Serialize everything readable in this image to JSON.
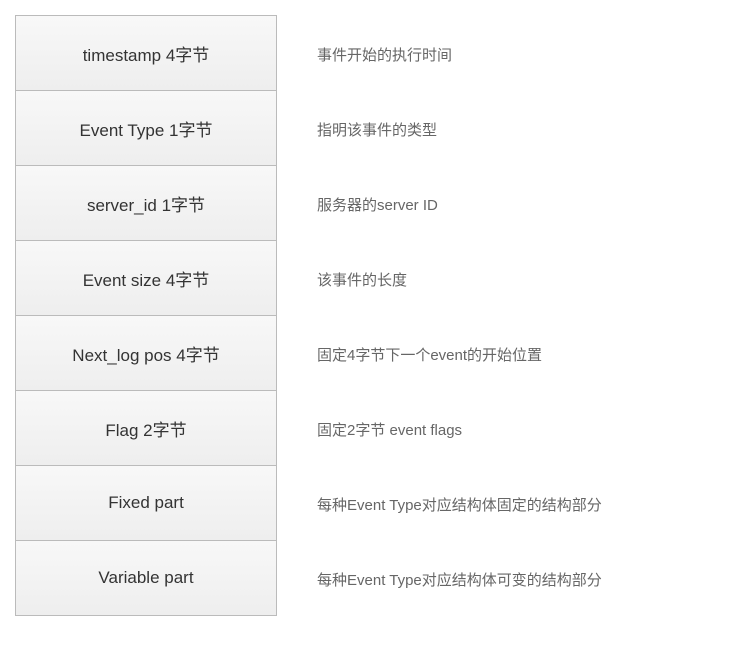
{
  "rows": [
    {
      "label": "timestamp 4字节",
      "description": "事件开始的执行时间"
    },
    {
      "label": "Event Type 1字节",
      "description": "指明该事件的类型"
    },
    {
      "label": "server_id 1字节",
      "description": "服务器的server ID"
    },
    {
      "label": "Event size  4字节",
      "description": "该事件的长度"
    },
    {
      "label": "Next_log pos 4字节",
      "description": "固定4字节下一个event的开始位置"
    },
    {
      "label": "Flag 2字节",
      "description": "固定2字节 event flags"
    },
    {
      "label": "Fixed part",
      "description": "每种Event Type对应结构体固定的结构部分"
    },
    {
      "label": "Variable part",
      "description": "每种Event Type对应结构体可变的结构部分"
    }
  ]
}
